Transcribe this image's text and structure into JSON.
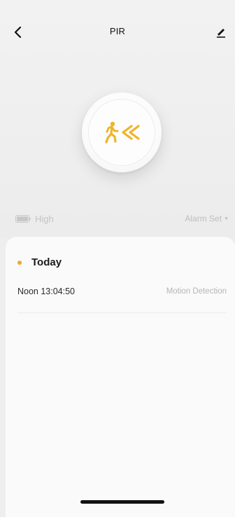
{
  "nav": {
    "title": "PIR",
    "back_icon": "chevron-left-icon",
    "edit_icon": "pencil-icon"
  },
  "sensor": {
    "icon": "running-person-motion-icon",
    "accent_color": "#f0b429"
  },
  "status": {
    "battery_label": "High",
    "battery_icon": "battery-icon",
    "alarm_label": "Alarm Set",
    "alarm_caret": "▼"
  },
  "log": {
    "day_label": "Today",
    "dot_color": "#f0a53a",
    "entries": [
      {
        "time": "Noon  13:04:50",
        "event": "Motion Detection"
      }
    ]
  }
}
